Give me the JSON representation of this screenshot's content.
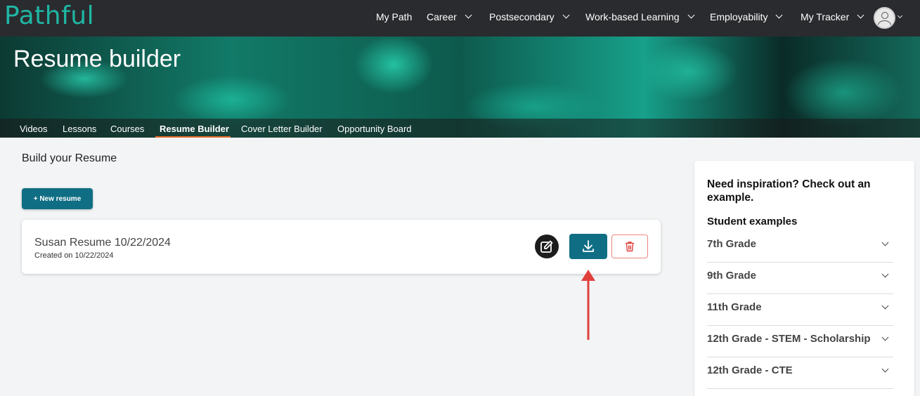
{
  "brand": {
    "logo_text": "Pathful",
    "accent": "#1fb7a4"
  },
  "topnav": {
    "items": [
      {
        "label": "My Path",
        "dropdown": false
      },
      {
        "label": "Career",
        "dropdown": true
      },
      {
        "label": "Postsecondary",
        "dropdown": true
      },
      {
        "label": "Work-based Learning",
        "dropdown": true
      },
      {
        "label": "Employability",
        "dropdown": true
      },
      {
        "label": "My Tracker",
        "dropdown": true
      }
    ]
  },
  "hero": {
    "title": "Resume builder"
  },
  "subnav": {
    "items": [
      "Videos",
      "Lessons",
      "Courses",
      "Resume Builder",
      "Cover Letter Builder",
      "Opportunity Board"
    ],
    "active": "Resume Builder"
  },
  "main": {
    "title": "Build your Resume",
    "new_button": "+ New resume",
    "resume": {
      "name": "Susan Resume 10/22/2024",
      "created": "Created on 10/22/2024"
    }
  },
  "side": {
    "heading": "Need inspiration? Check out an example.",
    "subheading": "Student examples",
    "items": [
      "7th Grade",
      "9th Grade",
      "11th Grade",
      "12th Grade - STEM - Scholarship",
      "12th Grade - CTE"
    ]
  },
  "colors": {
    "primary": "#0f6e84",
    "danger": "#e8877f",
    "annotation": "#e0403c",
    "active_tab": "#e46b2a"
  }
}
